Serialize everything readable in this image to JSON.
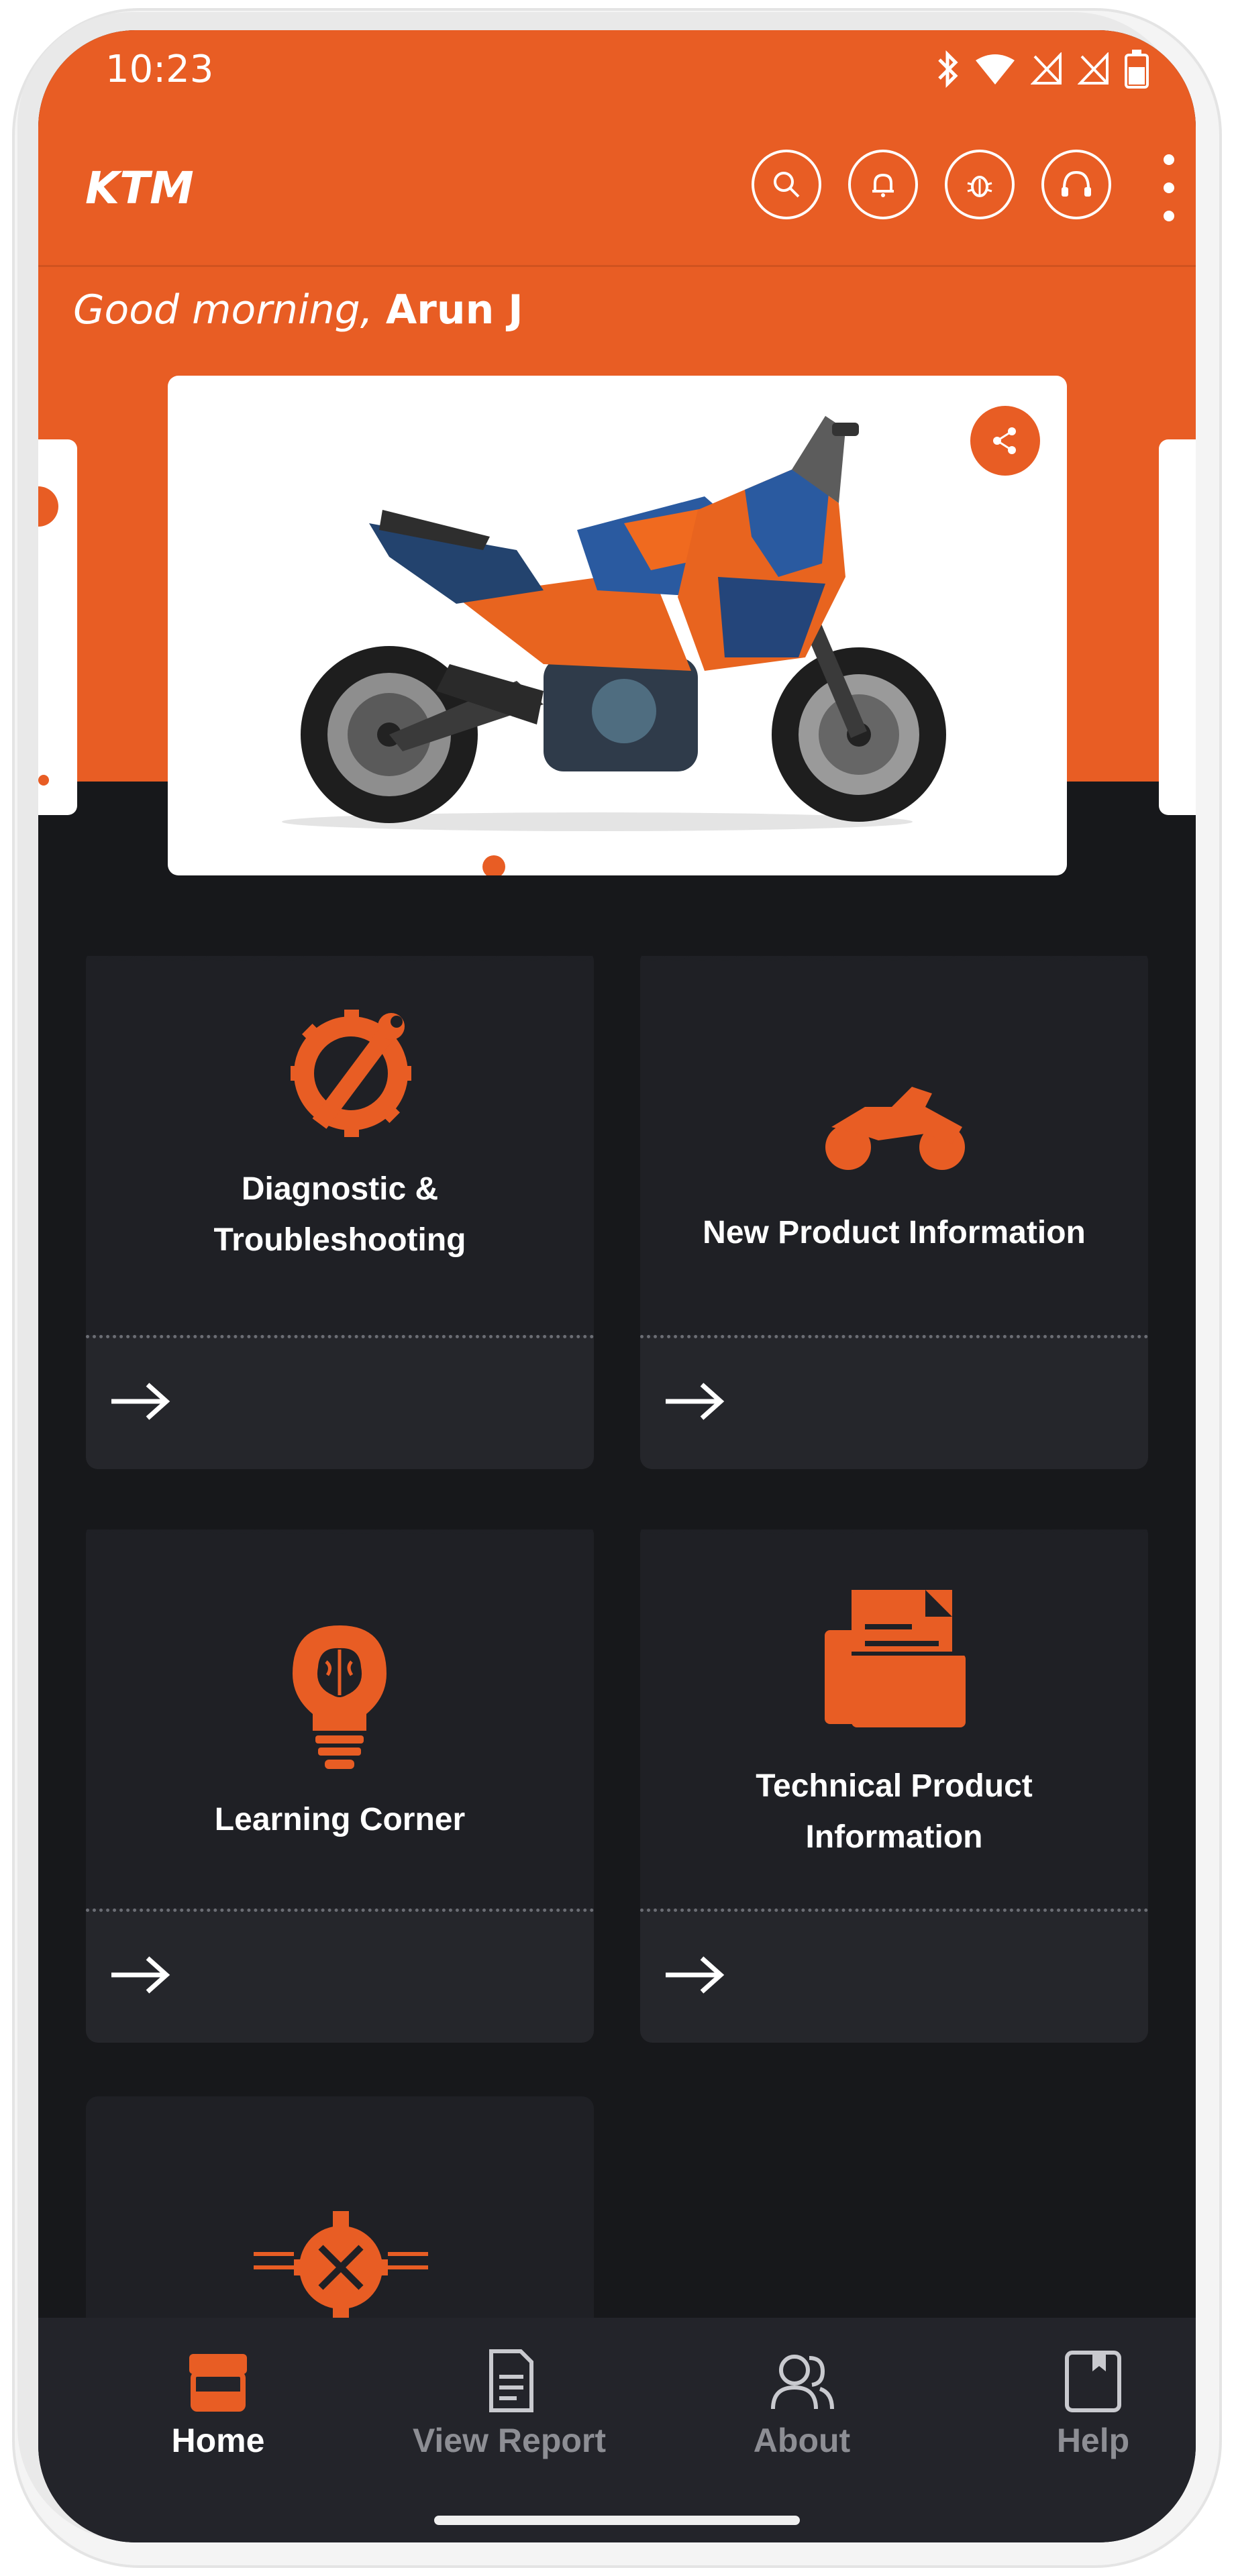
{
  "status_bar": {
    "time": "10:23"
  },
  "header": {
    "brand": "KTM"
  },
  "greeting": {
    "text": "Good morning, ",
    "name": "Arun J"
  },
  "tiles": [
    {
      "title_line1": "Diagnostic &",
      "title_line2": "Troubleshooting",
      "icon": "gear-wrench-icon"
    },
    {
      "title_line1": "New Product Information",
      "title_line2": "",
      "icon": "motorcycle-icon"
    },
    {
      "title_line1": "Learning Corner",
      "title_line2": "",
      "icon": "bulb-brain-icon"
    },
    {
      "title_line1": "Technical Product",
      "title_line2": "Information",
      "icon": "documents-icon"
    }
  ],
  "bottom_nav": {
    "items": [
      {
        "label": "Home",
        "icon": "store-icon",
        "active": true
      },
      {
        "label": "View Report",
        "icon": "report-icon",
        "active": false
      },
      {
        "label": "About",
        "icon": "users-icon",
        "active": false
      },
      {
        "label": "Help",
        "icon": "bookmark-icon",
        "active": false
      }
    ]
  },
  "colors": {
    "accent": "#e85d24",
    "background": "#17181b",
    "card": "#1f2025"
  }
}
